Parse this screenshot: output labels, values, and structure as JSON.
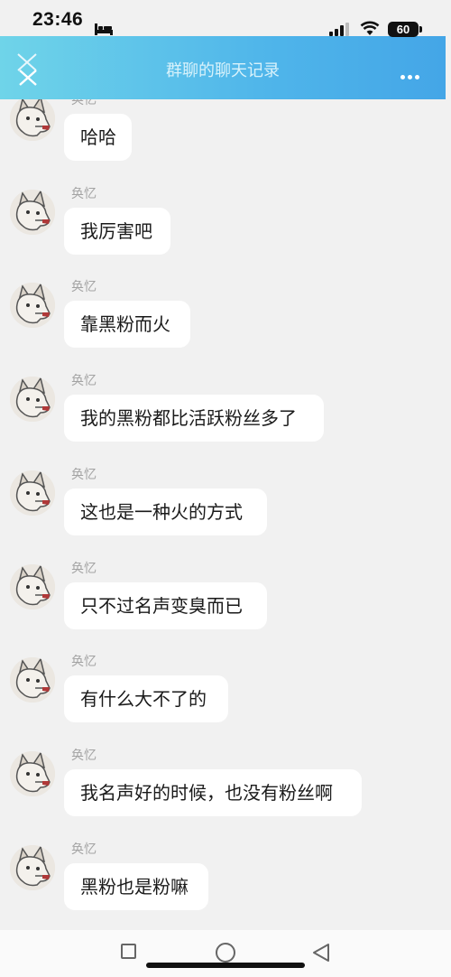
{
  "status": {
    "time": "23:46",
    "battery": "60"
  },
  "header": {
    "title": "群聊的聊天记录"
  },
  "messages": [
    {
      "sender": "奂忆",
      "text": "哈哈"
    },
    {
      "sender": "奂忆",
      "text": "我厉害吧"
    },
    {
      "sender": "奂忆",
      "text": "靠黑粉而火"
    },
    {
      "sender": "奂忆",
      "text": "我的黑粉都比活跃粉丝多了"
    },
    {
      "sender": "奂忆",
      "text": "这也是一种火的方式"
    },
    {
      "sender": "奂忆",
      "text": "只不过名声变臭而已"
    },
    {
      "sender": "奂忆",
      "text": "有什么大不了的"
    },
    {
      "sender": "奂忆",
      "text": "我名声好的时候，也没有粉丝啊"
    },
    {
      "sender": "奂忆",
      "text": "黑粉也是粉嘛"
    }
  ]
}
